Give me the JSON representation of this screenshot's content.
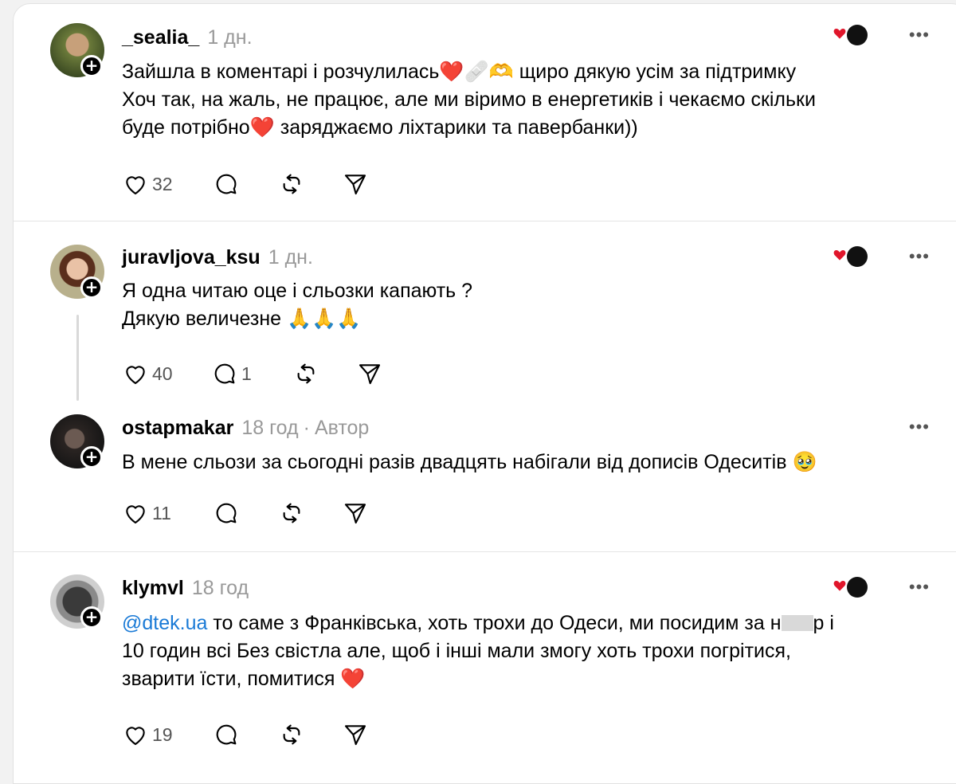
{
  "posts": [
    {
      "username": "_sealia_",
      "time": "1 дн.",
      "lines": [
        "Зайшла в коментарі і розчулилась❤️🩹🫶 щиро дякую усім за підтримку",
        "Хоч так, на жаль, не працює, але ми віримо в енергетиків і чекаємо скільки",
        "буде потрібно❤️ заряджаємо ліхтарики та павербанки))"
      ],
      "likes": "32",
      "replies": ""
    },
    {
      "username": "juravljova_ksu",
      "time": "1 дн.",
      "lines": [
        "Я одна читаю оце і сльозки капають ?",
        "Дякую величезне 🙏🙏🙏"
      ],
      "likes": "40",
      "replies": "1"
    },
    {
      "username": "ostapmakar",
      "time": "18 год",
      "dot": "·",
      "author_label": "Автор",
      "lines": [
        "В мене сльози за сьогодні разів двадцять набігали від дописів Одеситів 🥹"
      ],
      "likes": "11",
      "replies": ""
    },
    {
      "username": "klymvl",
      "time": "18 год",
      "mention": "@dtek.ua",
      "line1_rest": " то саме з Франківська, хоть трохи до Одеси, ми посидим за н",
      "line1_end": "р і",
      "lines": [
        "10 годин всі Без свістла але, щоб і інші мали змогу хоть трохи погрітися,",
        "зварити їсти, помитися ❤️"
      ],
      "likes": "19",
      "replies": ""
    }
  ],
  "icons": {
    "more": "more-icon",
    "like": "heart-icon",
    "reply": "comment-icon",
    "repost": "repost-icon",
    "share": "send-icon"
  },
  "colors": {
    "mention": "#1a7ad6",
    "heart": "#e0162b",
    "muted": "#999999"
  }
}
